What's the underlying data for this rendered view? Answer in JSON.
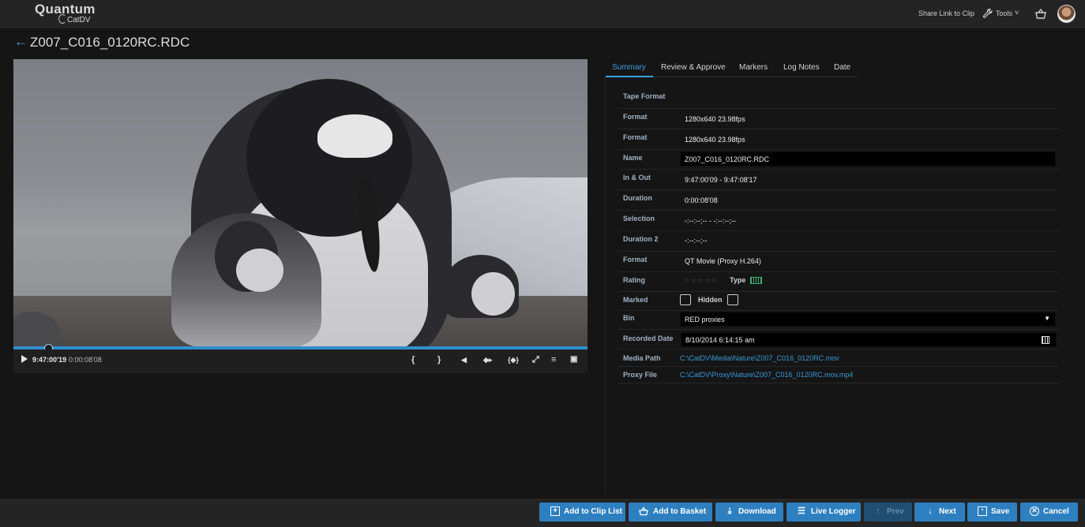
{
  "brand": {
    "name": "Quantum",
    "product": "CatDV"
  },
  "header": {
    "share_link": "Share Link to Clip",
    "tools": "Tools",
    "tools_caret": "˅"
  },
  "clip": {
    "back_icon": "←",
    "title": "Z007_C016_0120RC.RDC"
  },
  "player": {
    "current_timecode": "9:47:00'19",
    "elapsed": "0:00:08'08",
    "controls": {
      "mark_in": "{",
      "mark_out": "}",
      "step_back": "◀",
      "go_in_out": "◆▸",
      "expand_selection": "{◆}",
      "fullscreen": "⤢",
      "equalizer": "≡",
      "snapshot": "▣"
    }
  },
  "tabs": [
    "Summary",
    "Review & Approve",
    "Markers",
    "Log Notes",
    "Date"
  ],
  "active_tab": "Summary",
  "fields": {
    "tape_format_label": "Tape Format",
    "format1_label": "Format",
    "format1_value": "1280x640 23.98fps",
    "format2_label": "Format",
    "format2_value": "1280x640 23.98fps",
    "name_label": "Name",
    "name_value": "Z007_C016_0120RC.RDC",
    "in_out_label": "In & Out",
    "in_out_value": "9:47:00'09 - 9:47:08'17",
    "duration_label": "Duration",
    "duration_value": "0:00:08'08",
    "selection_label": "Selection",
    "selection_value": "-:--:--;-- - -:--:--;--",
    "duration2_label": "Duration 2",
    "duration2_value": "-:--:--;--",
    "format3_label": "Format",
    "format3_value": "QT Movie (Proxy H.264)",
    "rating_label": "Rating",
    "rating_stars": "☆☆☆☆☆",
    "type_label": "Type",
    "marked_label": "Marked",
    "hidden_label": "Hidden",
    "bin_label": "Bin",
    "bin_value": "RED proxies",
    "recorded_date_label": "Recorded Date",
    "recorded_date_value": "8/10/2014 6:14:15 am",
    "media_path_label": "Media Path",
    "media_path_value": "C:\\CatDV\\Media\\Nature\\Z007_C016_0120RC.mov",
    "proxy_file_label": "Proxy File",
    "proxy_file_value": "C:\\CatDV\\Proxy\\Nature\\Z007_C016_0120RC.mov.mp4"
  },
  "footer": {
    "add_to_clip_list": "Add to Clip List",
    "add_to_basket": "Add to Basket",
    "download": "Download",
    "live_logger": "Live Logger",
    "prev": "Prev",
    "next": "Next",
    "save": "Save",
    "cancel": "Cancel"
  },
  "icons": {
    "play": "play-icon",
    "wrench": "wrench-icon",
    "basket": "basket-icon",
    "calendar": "calendar-icon",
    "film": "film-icon"
  },
  "colors": {
    "accent": "#3ea0e0",
    "button": "#2e7fc0",
    "label": "#9fb3c6"
  },
  "playback_progress": 0.06
}
